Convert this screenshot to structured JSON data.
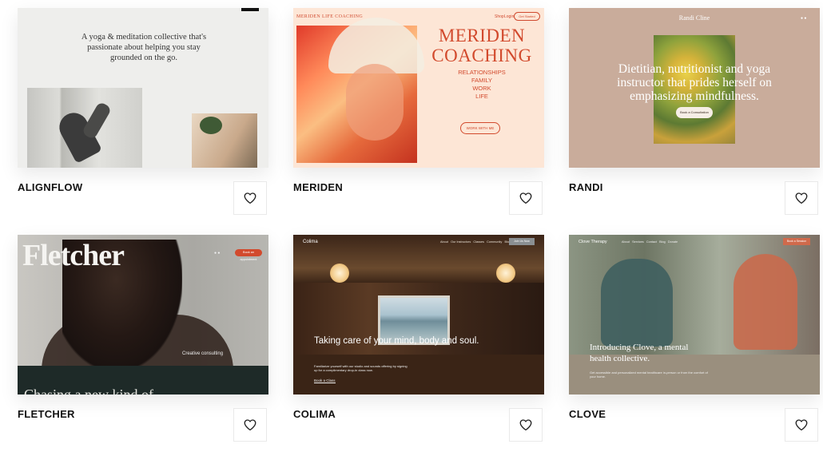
{
  "colors": {
    "heart": "#222222",
    "meriden_accent": "#d24a2d",
    "page_background": "#ffffff"
  },
  "templates": [
    {
      "name": "ALIGNFLOW",
      "preview": {
        "tagline": "A yoga & meditation collective that's passionate about helping you stay grounded on the go."
      }
    },
    {
      "name": "MERIDEN",
      "preview": {
        "logo": "MERIDEN LIFE COACHING",
        "nav_links": [
          "Shop",
          "Login"
        ],
        "nav_button": "Get Started",
        "title": "MERIDEN COACHING",
        "topics": [
          "RELATIONSHIPS",
          "FAMILY",
          "WORK",
          "LIFE"
        ],
        "button": "WORK WITH ME"
      }
    },
    {
      "name": "RANDI",
      "preview": {
        "brand": "Randi Cline",
        "headline": "Dietitian, nutritionist and yoga instructor that prides herself on emphasizing mindfulness.",
        "button": "Book a Consultation"
      }
    },
    {
      "name": "FLETCHER",
      "preview": {
        "logo": "Fletcher",
        "nav_button": "Book an appointment",
        "category": "Creative consulting",
        "band_text": "Chasing a new kind of"
      }
    },
    {
      "name": "COLIMA",
      "preview": {
        "logo": "Colima",
        "nav_links": [
          "About",
          "Our Instructors",
          "Classes",
          "Community",
          "Blog"
        ],
        "nav_button": "Join Us Now",
        "headline": "Taking care of your mind, body and soul.",
        "body": "Familiarize yourself with our studio and sounds offering by signing up for a complimentary drop-in class now.",
        "link": "Book a Class"
      }
    },
    {
      "name": "CLOVE",
      "preview": {
        "logo": "Clove Therapy",
        "nav_links": [
          "About",
          "Services",
          "Contact",
          "Blog",
          "Donate"
        ],
        "nav_button": "Book a Session",
        "headline": "Introducing Clove, a mental health collective.",
        "body": "Get accessible and personalized mental healthcare in-person or from the comfort of your home."
      }
    }
  ]
}
